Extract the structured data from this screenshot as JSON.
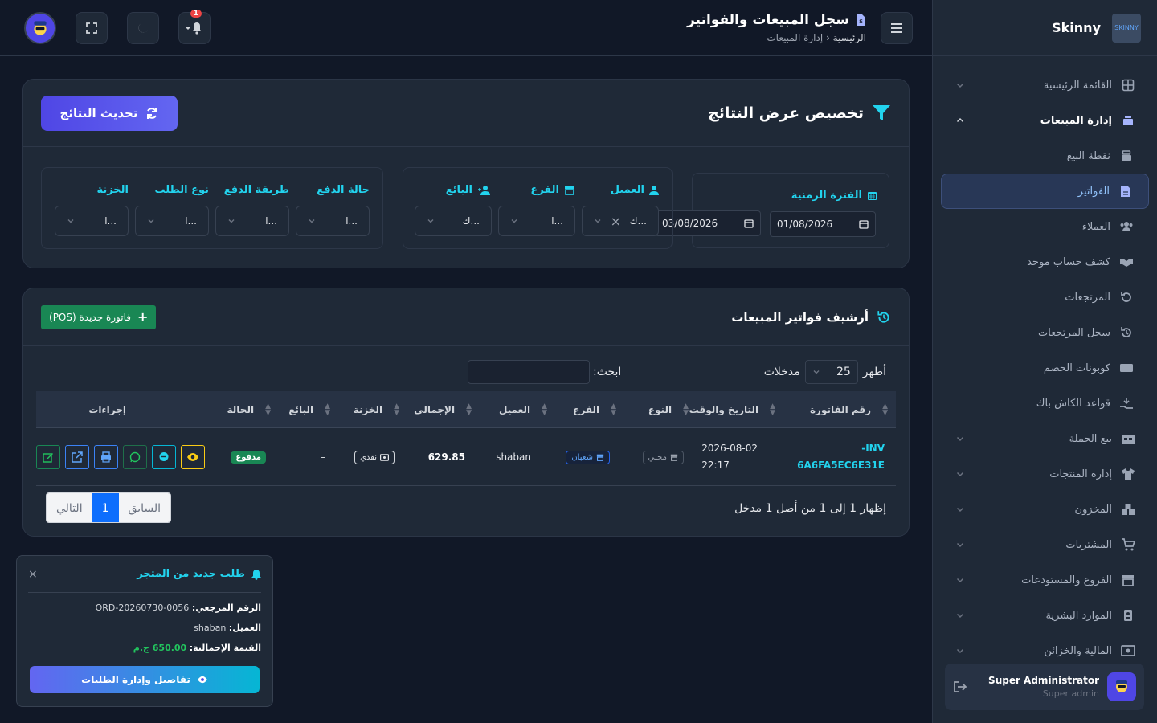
{
  "brand": {
    "name": "Skinny",
    "logo_text": "SKINNY"
  },
  "sidebar": {
    "items": [
      {
        "label": "القائمة الرئيسية",
        "icon": "dashboard-icon"
      },
      {
        "label": "إدارة المبيعات",
        "icon": "register-icon"
      },
      {
        "label": "نقطة البيع",
        "icon": "cash-register-icon"
      },
      {
        "label": "الفواتير",
        "icon": "invoice-icon"
      },
      {
        "label": "العملاء",
        "icon": "users-icon"
      },
      {
        "label": "كشف حساب موحد",
        "icon": "handshake-icon"
      },
      {
        "label": "المرتجعات",
        "icon": "undo-icon"
      },
      {
        "label": "سجل المرتجعات",
        "icon": "history-icon"
      },
      {
        "label": "كوبونات الخصم",
        "icon": "ticket-icon"
      },
      {
        "label": "قواعد الكاش باك",
        "icon": "cashback-icon"
      },
      {
        "label": "بيع الجملة",
        "icon": "warehouse-icon"
      },
      {
        "label": "إدارة المنتجات",
        "icon": "tshirt-icon"
      },
      {
        "label": "المخزون",
        "icon": "boxes-icon"
      },
      {
        "label": "المشتريات",
        "icon": "cart-icon"
      },
      {
        "label": "الفروع والمستودعات",
        "icon": "store-icon"
      },
      {
        "label": "الموارد البشرية",
        "icon": "id-badge-icon"
      },
      {
        "label": "المالية والخزائن",
        "icon": "money-icon"
      }
    ]
  },
  "user": {
    "name": "Super Administrator",
    "role": "Super admin"
  },
  "header": {
    "title": "سجل المبيعات والفواتير",
    "crumb_home": "الرئيسية",
    "crumb_current": "إدارة المبيعات",
    "notif_count": "1"
  },
  "filter": {
    "title": "تخصيص عرض النتائج",
    "refresh": "تحديث النتائج",
    "period_label": "الفترة الزمنية",
    "date_from": "01/08/2026",
    "date_to": "03/08/2026",
    "customer_label": "العميل",
    "branch_label": "الفرع",
    "seller_label": "البائع",
    "customer_val": "ك...",
    "branch_val": "ا...",
    "seller_val": "ك...",
    "pay_status_label": "حالة الدفع",
    "pay_method_label": "طريقة الدفع",
    "order_type_label": "نوع الطلب",
    "treasury_label": "الخزنة",
    "pay_status_val": "ا...",
    "pay_method_val": "ا...",
    "order_type_val": "ا...",
    "treasury_val": "ا..."
  },
  "archive": {
    "title": "أرشيف فواتير المبيعات",
    "new_btn": "فاتورة جديدة (POS)",
    "show": "أظهر",
    "entries": "مدخلات",
    "page_len": "25",
    "search": "ابحث:",
    "columns": [
      "رقم الفاتورة",
      "التاريخ والوقت",
      "النوع",
      "الفرع",
      "العميل",
      "الإجمالي",
      "الخزنة",
      "البائع",
      "الحالة",
      "إجراءات"
    ],
    "row": {
      "invoice_1": "INV-",
      "invoice_2": "6A6FA5EC6E31E",
      "date": "2026-08-02",
      "time": "22:17",
      "type": "محلي",
      "branch": "شعبان",
      "customer": "shaban",
      "total": "629.85",
      "treasury": "نقدي",
      "seller": "–",
      "status": "مدفوع"
    },
    "info": "إظهار 1 إلى 1 من أصل 1 مدخل",
    "prev": "السابق",
    "page": "1",
    "next": "التالي"
  },
  "toast": {
    "title": "طلب جديد من المتجر",
    "ref_label": "الرقم المرجعي:",
    "ref_val": "ORD-20260730-0056",
    "cust_label": "العميل:",
    "cust_val": "shaban",
    "total_label": "القيمة الإجمالية:",
    "total_val": "650.00 ج.م",
    "btn": "تفاصيل وإدارة الطلبات"
  },
  "colors": {
    "accent": "#6366f1",
    "cyan": "#22d3ee",
    "green": "#198754",
    "bg": "#111827",
    "panel": "#1f2937"
  }
}
